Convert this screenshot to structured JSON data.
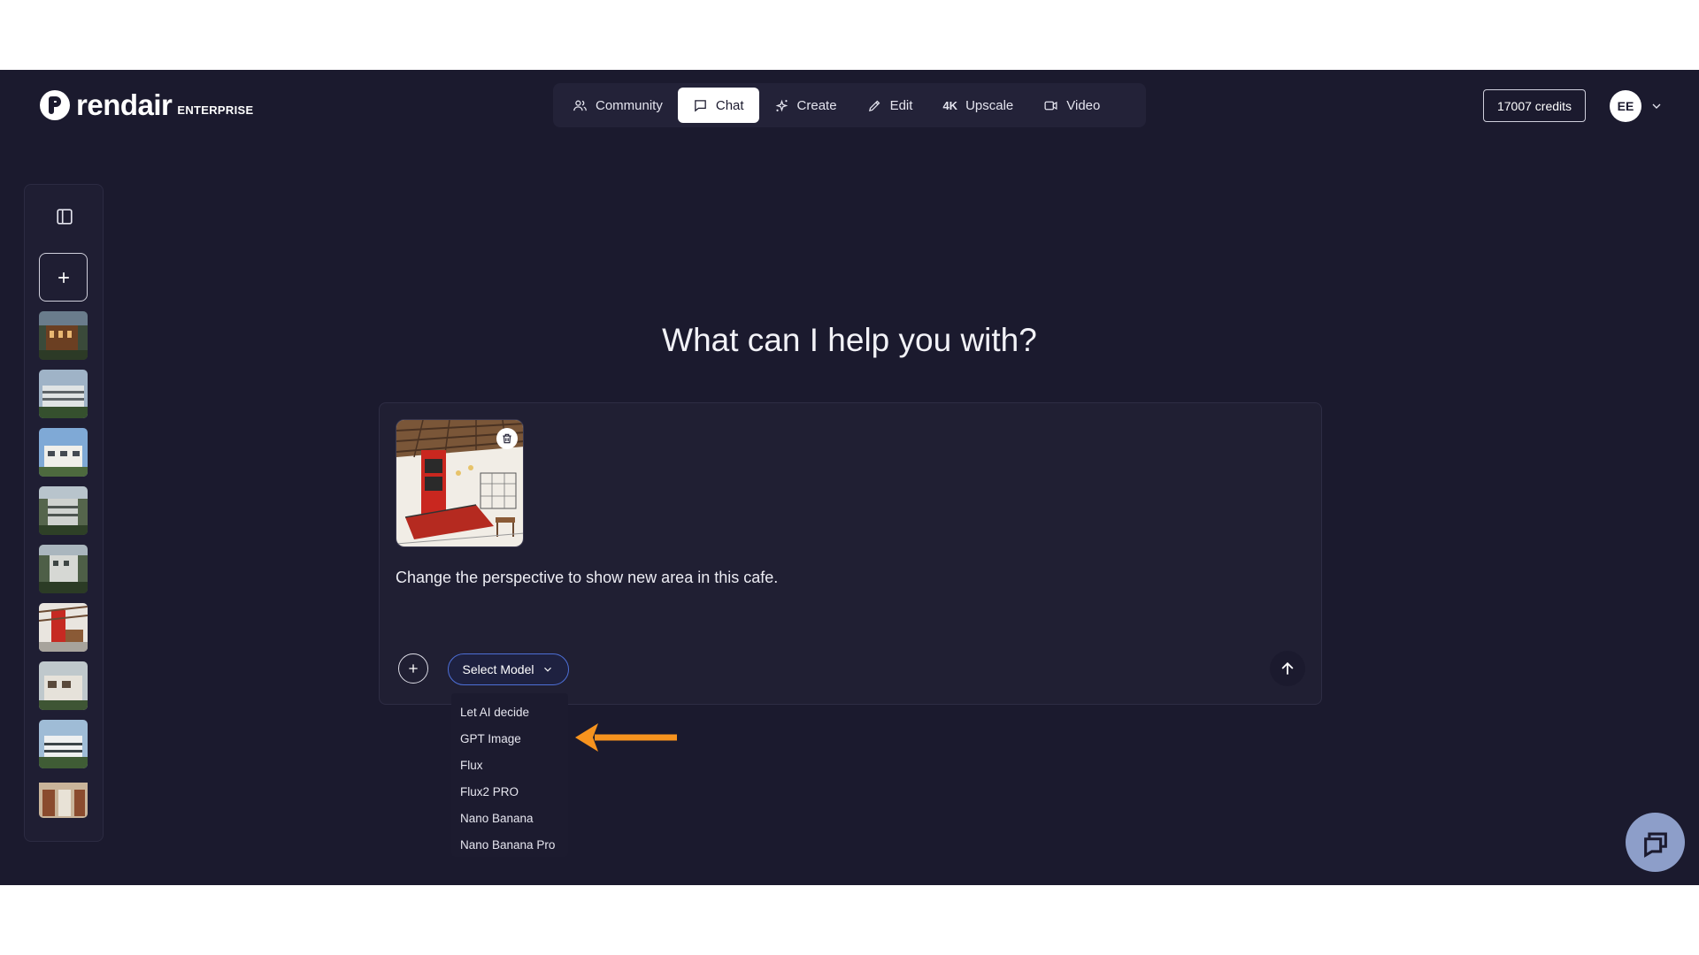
{
  "brand": {
    "name": "rendair",
    "tier": "ENTERPRISE"
  },
  "nav": {
    "items": [
      {
        "label": "Community",
        "icon": "users-icon",
        "active": false
      },
      {
        "label": "Chat",
        "icon": "chat-bubble-icon",
        "active": true
      },
      {
        "label": "Create",
        "icon": "sparkle-icon",
        "active": false
      },
      {
        "label": "Edit",
        "icon": "pencil-icon",
        "active": false
      },
      {
        "label": "Upscale",
        "icon": "4k-icon",
        "prefix": "4K",
        "active": false
      },
      {
        "label": "Video",
        "icon": "video-camera-icon",
        "active": false
      }
    ]
  },
  "account": {
    "credits": "17007 credits",
    "initials": "EE"
  },
  "sidebar": {
    "history_count": 9
  },
  "main": {
    "headline": "What can I help you with?",
    "prompt_text": "Change the perspective to show new area in this cafe.",
    "model_select_label": "Select Model"
  },
  "model_dropdown": {
    "options": [
      "Let AI decide",
      "GPT Image",
      "Flux",
      "Flux2 PRO",
      "Nano Banana",
      "Nano Banana Pro"
    ]
  },
  "colors": {
    "background": "#1b1a2e",
    "panel": "#201f33",
    "accent_border": "#4d6fd6",
    "annotation_arrow": "#f7931e",
    "fab": "#8d9ec9"
  }
}
